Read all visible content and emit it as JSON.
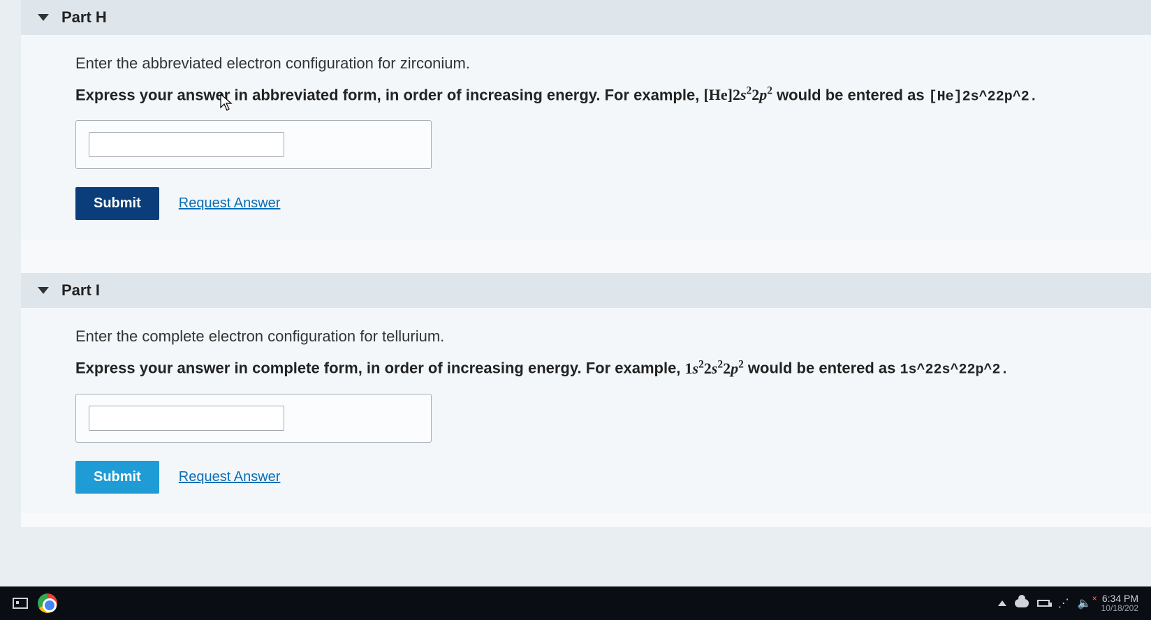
{
  "parts": [
    {
      "key": "H",
      "header": "Part H",
      "prompt": "Enter the abbreviated electron configuration for zirconium.",
      "instruction_prefix": "Express your answer in abbreviated form, in order of increasing energy. For example, ",
      "example_formula_html": "[He]2<span class='s'>s</span><sup>2</sup>2<span class='s'>p</span><sup>2</sup>",
      "instruction_mid": " would be entered as ",
      "example_plain": "[He]2s^22p^2.",
      "answer_value": "",
      "submit_label": "Submit",
      "request_label": "Request Answer",
      "submit_variant": "dark"
    },
    {
      "key": "I",
      "header": "Part I",
      "prompt": "Enter the complete electron configuration for tellurium.",
      "instruction_prefix": "Express your answer in complete form, in order of increasing energy. For example, ",
      "example_formula_html": "1<span class='s'>s</span><sup>2</sup>2<span class='s'>s</span><sup>2</sup>2<span class='s'>p</span><sup>2</sup>",
      "instruction_mid": " would be entered as ",
      "example_plain": "1s^22s^22p^2.",
      "answer_value": "",
      "submit_label": "Submit",
      "request_label": "Request Answer",
      "submit_variant": "light"
    }
  ],
  "taskbar": {
    "time": "6:34 PM",
    "date": "10/18/202"
  }
}
